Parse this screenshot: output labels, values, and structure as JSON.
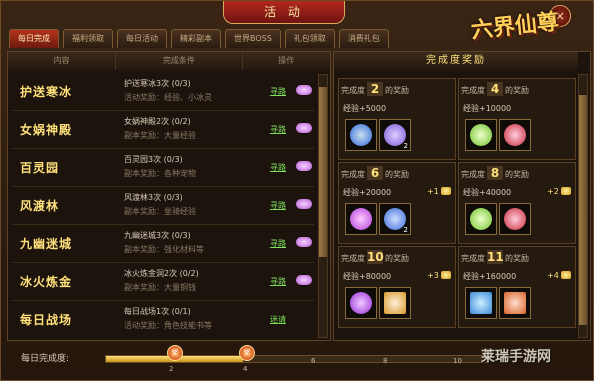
{
  "title": "活 动",
  "close_label": "×",
  "logo": "六界仙尊",
  "tabs": [
    {
      "label": "每日完成",
      "active": true
    },
    {
      "label": "福利领取",
      "active": false
    },
    {
      "label": "每日活动",
      "active": false
    },
    {
      "label": "精彩副本",
      "active": false
    },
    {
      "label": "世界BOSS",
      "active": false
    },
    {
      "label": "礼包领取",
      "active": false
    },
    {
      "label": "消费礼包",
      "active": false
    }
  ],
  "table_headers": [
    "内容",
    "完成条件",
    "操作"
  ],
  "rows": [
    {
      "name": "护送寒冰",
      "cond": "护送寒冰3次 (0/3)",
      "reward": "活动奖励：经验、小冰灵",
      "action": "寻路"
    },
    {
      "name": "女娲神殿",
      "cond": "女娲神殿2次 (0/2)",
      "reward": "副本奖励：大量经验",
      "action": "寻路"
    },
    {
      "name": "百灵园",
      "cond": "百灵园3次 (0/3)",
      "reward": "副本奖励：各种宠物",
      "action": "寻路"
    },
    {
      "name": "风渡林",
      "cond": "风渡林3次 (0/3)",
      "reward": "副本奖励：坐骑经验",
      "action": "寻路"
    },
    {
      "name": "九幽迷城",
      "cond": "九幽迷城3次 (0/3)",
      "reward": "副本奖励：强化材料等",
      "action": "寻路"
    },
    {
      "name": "冰火炼金",
      "cond": "冰火炼金洞2次 (0/2)",
      "reward": "副本奖励：大量铜钱",
      "action": "寻路"
    },
    {
      "name": "每日战场",
      "cond": "每日战场1次 (0/1)",
      "reward": "活动奖励：角色技能书等",
      "action": "迷请"
    }
  ],
  "reward_title": "完成度奖励",
  "reward_cards": [
    {
      "prefix": "完成度",
      "num": "2",
      "suffix": "的奖励",
      "exp": "经验+5000",
      "plus": "",
      "items": [
        {
          "color": "#2a6bd8",
          "count": ""
        },
        {
          "color": "#7a5ad8",
          "count": "2"
        }
      ]
    },
    {
      "prefix": "完成度",
      "num": "4",
      "suffix": "的奖励",
      "exp": "经验+10000",
      "plus": "",
      "items": [
        {
          "color": "#6fc32a",
          "count": ""
        },
        {
          "color": "#c82a3a",
          "count": ""
        }
      ]
    },
    {
      "prefix": "完成度",
      "num": "6",
      "suffix": "的奖励",
      "exp": "经验+20000",
      "plus": "+1",
      "items": [
        {
          "color": "#b03ad8",
          "count": ""
        },
        {
          "color": "#3a6ad8",
          "count": "2"
        }
      ]
    },
    {
      "prefix": "完成度",
      "num": "8",
      "suffix": "的奖励",
      "exp": "经验+40000",
      "plus": "+2",
      "items": [
        {
          "color": "#6fc32a",
          "count": ""
        },
        {
          "color": "#c82a3a",
          "count": ""
        }
      ]
    },
    {
      "prefix": "完成度",
      "num": "10",
      "suffix": "的奖励",
      "exp": "经验+80000",
      "plus": "+3",
      "items": [
        {
          "color": "#9a2ad8",
          "count": ""
        },
        {
          "color": "#d89a2a",
          "count": ""
        }
      ]
    },
    {
      "prefix": "完成度",
      "num": "11",
      "suffix": "的奖励",
      "exp": "经验+160000",
      "plus": "+4",
      "items": [
        {
          "color": "#3a8ad8",
          "count": ""
        },
        {
          "color": "#d8642a",
          "count": ""
        }
      ]
    }
  ],
  "footer_label": "每日完成度:",
  "progress_ticks": [
    "2",
    "4",
    "6",
    "8",
    "10"
  ],
  "progress_value": 0.36,
  "badges": [
    "奖",
    "奖"
  ],
  "watermark": "莱瑞手游网"
}
